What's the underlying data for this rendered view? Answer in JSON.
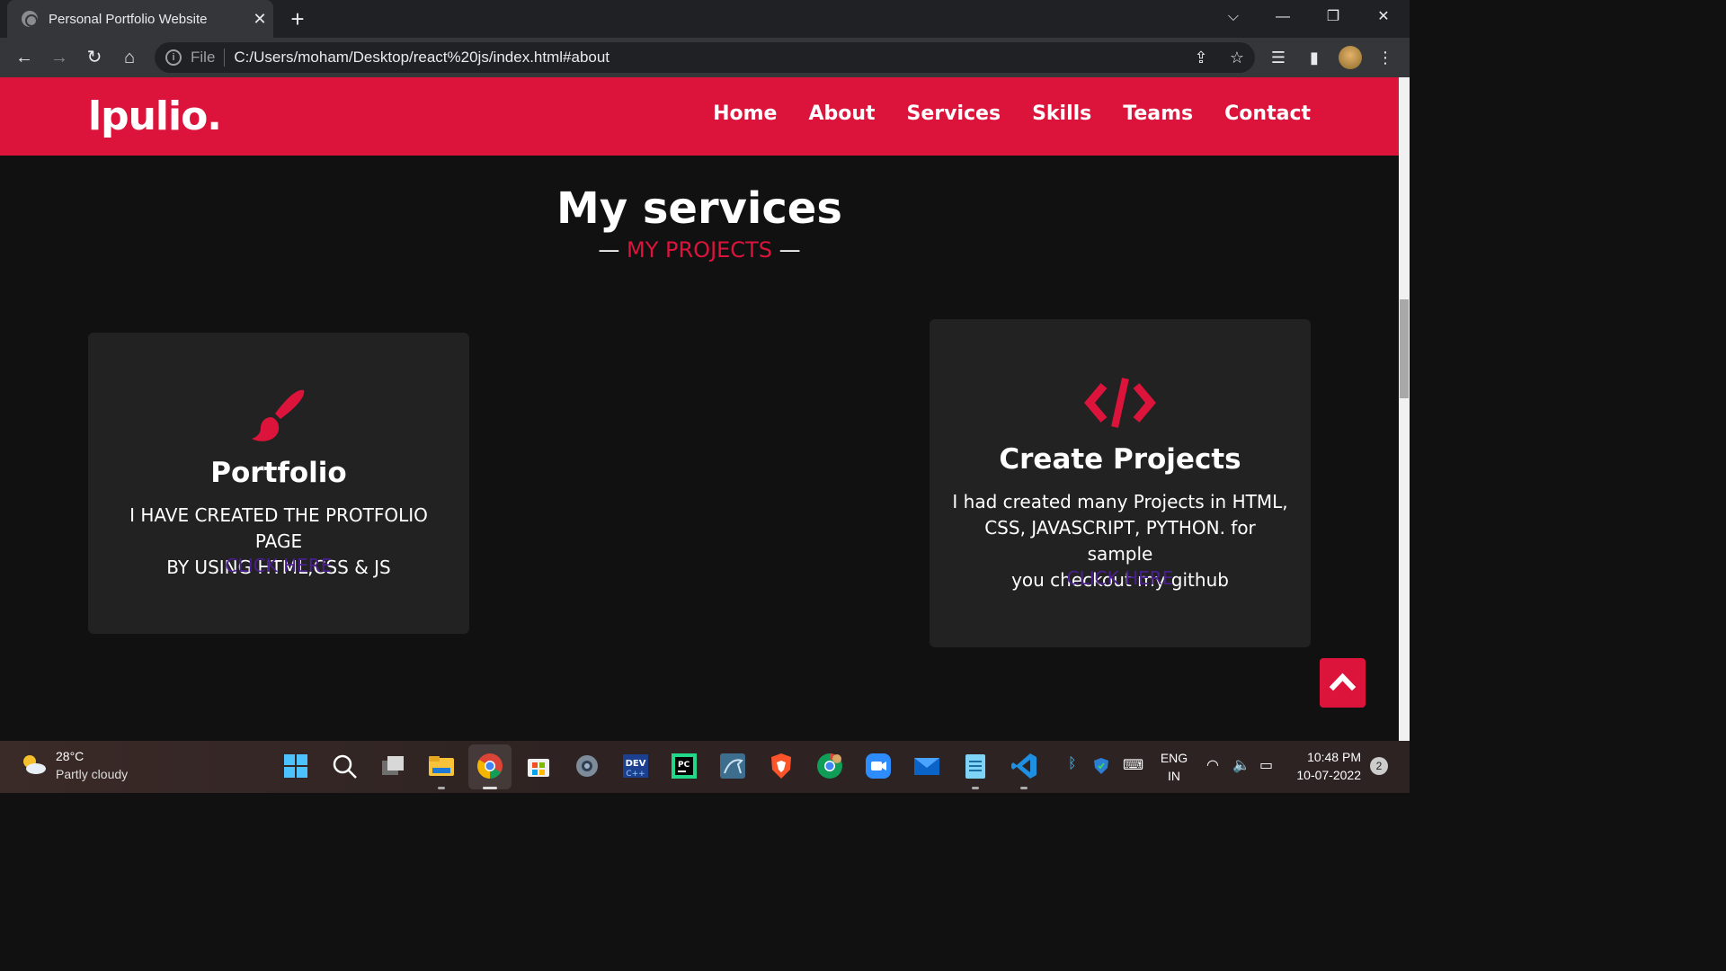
{
  "browser": {
    "tab_title": "Personal Portfolio Website",
    "tab_close": "✕",
    "new_tab": "+",
    "file_label": "File",
    "url": "C:/Users/moham/Desktop/react%20js/index.html#about"
  },
  "site": {
    "logo": "lpulio.",
    "nav": [
      "Home",
      "About",
      "Services",
      "Skills",
      "Teams",
      "Contact"
    ]
  },
  "services": {
    "title": "My services",
    "subtitle": "MY PROJECTS",
    "dash": "—",
    "cards": [
      {
        "icon": "paint-brush-icon",
        "heading": "Portfolio",
        "text_lines": [
          "I HAVE CREATED THE PROTFOLIO PAGE",
          "BY USING HTML,CSS & JS"
        ],
        "link": "CLICK HERE"
      },
      {
        "icon": "code-icon",
        "heading": "Create Projects",
        "text_lines": [
          "I had created many Projects in HTML,",
          "CSS, JAVASCRIPT, PYTHON. for sample",
          "you checkout my github"
        ],
        "link": "CLICK HERE"
      }
    ]
  },
  "taskbar": {
    "weather_temp": "28°C",
    "weather_cond": "Partly cloudy",
    "lang_line1": "ENG",
    "lang_line2": "IN",
    "time": "10:48 PM",
    "date": "10-07-2022",
    "notifications": "2"
  },
  "colors": {
    "accent": "#dc143c",
    "page_bg": "#111111",
    "card_bg": "#222222",
    "link": "#4b1f8f"
  }
}
